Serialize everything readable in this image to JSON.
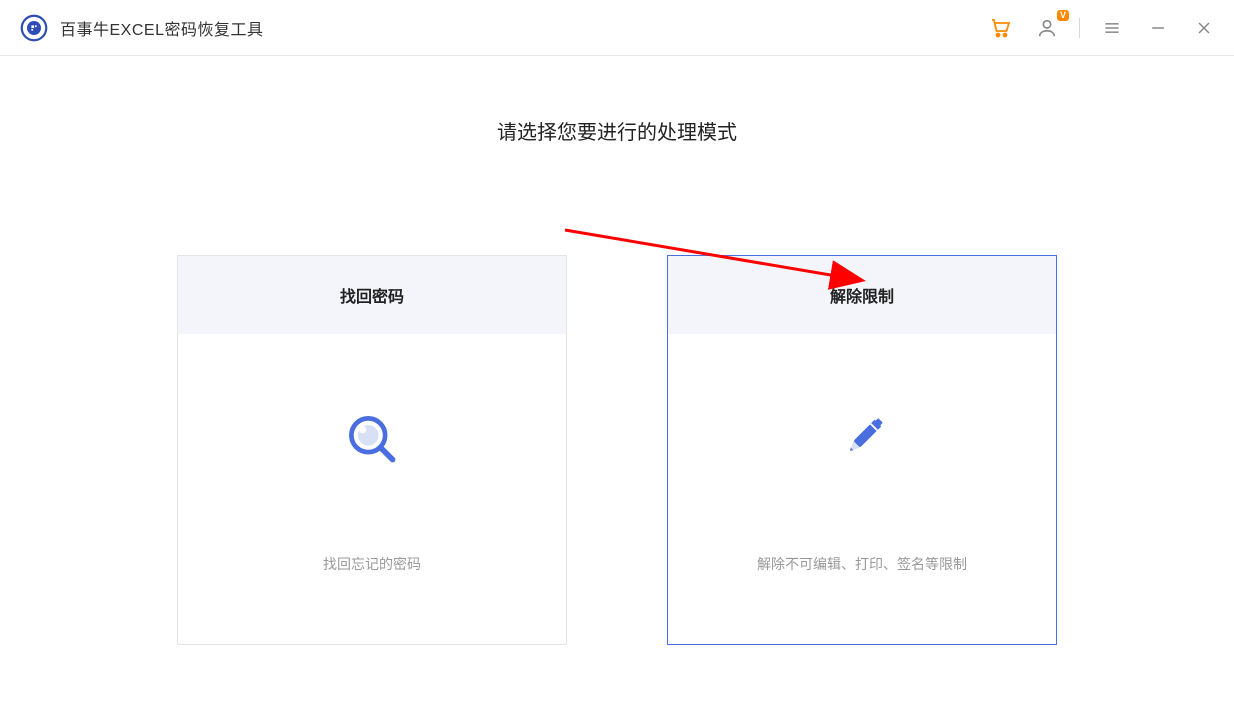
{
  "header": {
    "app_title": "百事牛EXCEL密码恢复工具",
    "vip_badge": "V"
  },
  "main": {
    "page_title": "请选择您要进行的处理模式",
    "cards": [
      {
        "title": "找回密码",
        "desc": "找回忘记的密码",
        "selected": false
      },
      {
        "title": "解除限制",
        "desc": "解除不可编辑、打印、签名等限制",
        "selected": true
      }
    ]
  }
}
